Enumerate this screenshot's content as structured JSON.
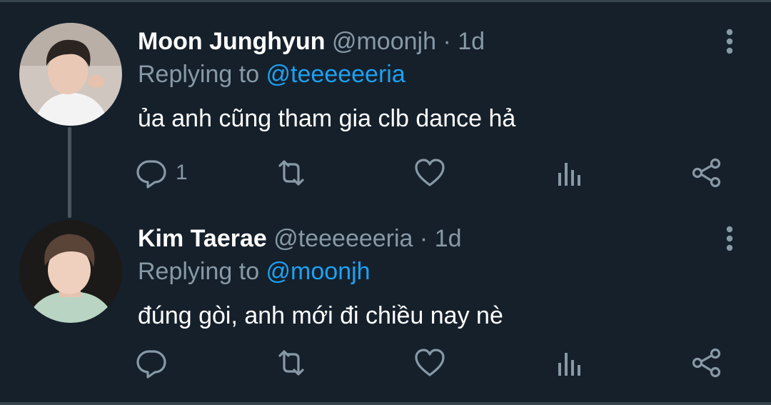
{
  "tweets": [
    {
      "display_name": "Moon Junghyun",
      "handle": "@moonjh",
      "separator": "·",
      "timestamp": "1d",
      "replying_prefix": "Replying to ",
      "replying_handle": "@teeeeeeria",
      "text": "ủa anh cũng tham gia clb dance hả",
      "reply_count": "1",
      "avatar_icon": "avatar-photo"
    },
    {
      "display_name": "Kim Taerae",
      "handle": "@teeeeeeria",
      "separator": "·",
      "timestamp": "1d",
      "replying_prefix": "Replying to ",
      "replying_handle": "@moonjh",
      "text": "đúng gòi, anh mới đi chiều nay nè",
      "reply_count": "",
      "avatar_icon": "avatar-photo"
    }
  ],
  "icons": {
    "reply": "reply-icon",
    "retweet": "retweet-icon",
    "like": "heart-icon",
    "views": "analytics-icon",
    "share": "share-icon",
    "more": "more-vertical-icon"
  },
  "colors": {
    "background": "#15202b",
    "divider": "#38444d",
    "primary_text": "#ffffff",
    "secondary_text": "#8899a6",
    "accent": "#1da1f2"
  }
}
